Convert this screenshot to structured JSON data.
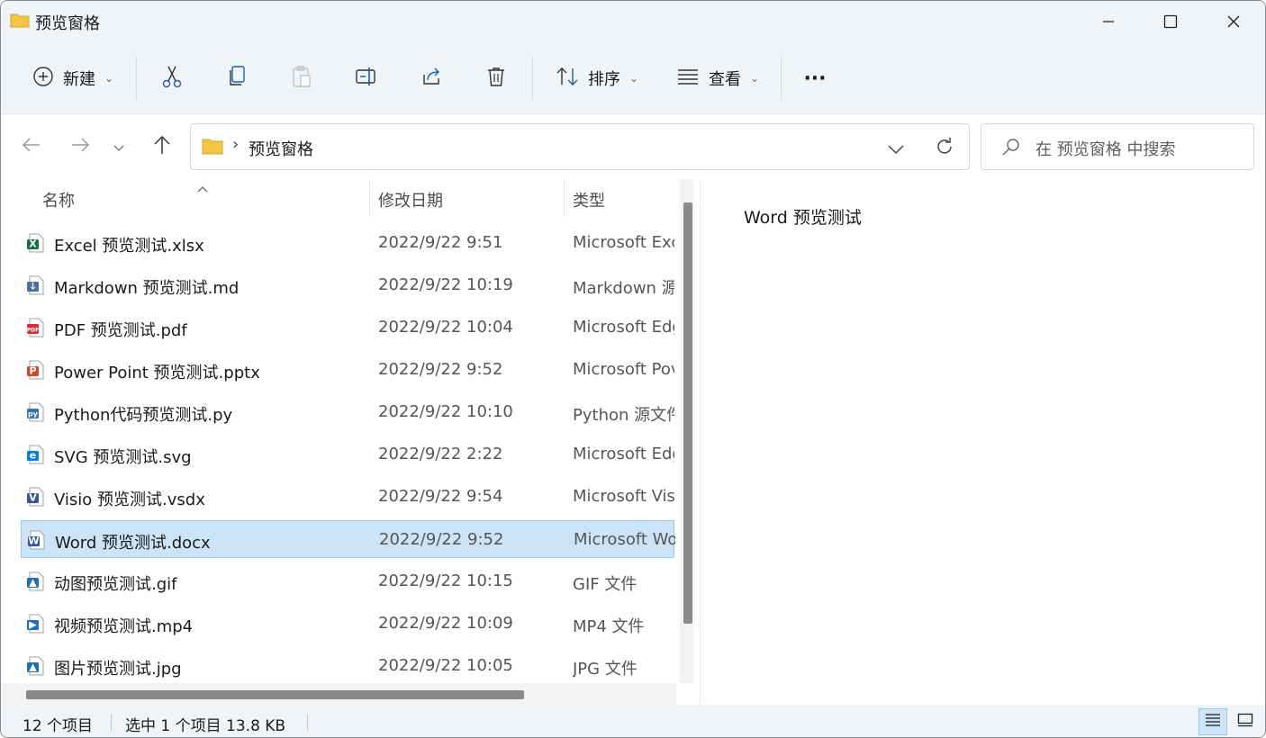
{
  "window": {
    "title": "预览窗格",
    "controls": {
      "minimize": "─",
      "maximize": "☐",
      "close": "✕"
    }
  },
  "toolbar": {
    "new_label": "新建",
    "sort_label": "排序",
    "view_label": "查看",
    "more_label": "···",
    "icons": [
      "plus-circle-icon",
      "cut-icon",
      "copy-icon",
      "paste-icon",
      "rename-icon",
      "share-icon",
      "delete-icon",
      "sort-icon",
      "view-icon"
    ]
  },
  "navigation": {
    "path_separator": "›",
    "path": "预览窗格",
    "search_placeholder": "在 预览窗格 中搜索"
  },
  "file_list": {
    "columns": {
      "name": "名称",
      "date": "修改日期",
      "type": "类型"
    },
    "rows": [
      {
        "name": "Excel 预览测试.xlsx",
        "date": "2022/9/22 9:51",
        "type": "Microsoft Exc",
        "icon": "excel-icon",
        "color": "#1d6f42",
        "glyph": "X"
      },
      {
        "name": "Markdown 预览测试.md",
        "date": "2022/9/22 10:19",
        "type": "Markdown 源",
        "icon": "markdown-icon",
        "color": "#4a6fa5",
        "glyph": "↓"
      },
      {
        "name": "PDF 预览测试.pdf",
        "date": "2022/9/22 10:04",
        "type": "Microsoft Edg",
        "icon": "pdf-icon",
        "color": "#d32f2f",
        "glyph": "PDF"
      },
      {
        "name": "Power Point 预览测试.pptx",
        "date": "2022/9/22 9:52",
        "type": "Microsoft Pov",
        "icon": "powerpoint-icon",
        "color": "#d24726",
        "glyph": "P"
      },
      {
        "name": "Python代码预览测试.py",
        "date": "2022/9/22 10:10",
        "type": "Python 源文件",
        "icon": "python-icon",
        "color": "#3572a5",
        "glyph": "py"
      },
      {
        "name": "SVG 预览测试.svg",
        "date": "2022/9/22 2:22",
        "type": "Microsoft Edg",
        "icon": "edge-icon",
        "color": "#0c7cd5",
        "glyph": "e"
      },
      {
        "name": "Visio 预览测试.vsdx",
        "date": "2022/9/22 9:54",
        "type": "Microsoft Visi",
        "icon": "visio-icon",
        "color": "#3955a3",
        "glyph": "V"
      },
      {
        "name": "Word 预览测试.docx",
        "date": "2022/9/22 9:52",
        "type": "Microsoft Wo",
        "icon": "word-icon",
        "color": "#2b579a",
        "glyph": "W",
        "selected": true
      },
      {
        "name": "动图预览测试.gif",
        "date": "2022/9/22 10:15",
        "type": "GIF 文件",
        "icon": "image-file-icon",
        "color": "#1e6fb8",
        "glyph": "▲"
      },
      {
        "name": "视频预览测试.mp4",
        "date": "2022/9/22 10:09",
        "type": "MP4 文件",
        "icon": "video-file-icon",
        "color": "#1e6fb8",
        "glyph": "▶"
      },
      {
        "name": "图片预览测试.jpg",
        "date": "2022/9/22 10:05",
        "type": "JPG 文件",
        "icon": "image-file-icon",
        "color": "#1e6fb8",
        "glyph": "▲"
      }
    ]
  },
  "preview": {
    "text": "Word  预览测试"
  },
  "status_bar": {
    "item_count": "12 个项目",
    "selection": "选中 1 个项目  13.8 KB"
  },
  "colors": {
    "chrome_bg": "#eff4f9",
    "selection_bg": "#cce4f7",
    "selection_border": "#99c9ef",
    "folder": "#f4c542"
  }
}
